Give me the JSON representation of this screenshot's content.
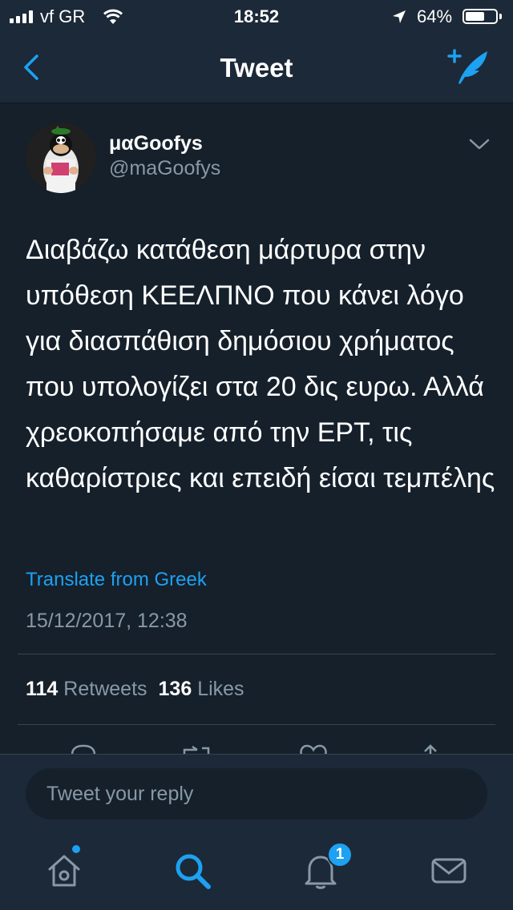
{
  "status_bar": {
    "carrier": "vf GR",
    "time": "18:52",
    "battery_percent": "64%",
    "battery_level": 0.64
  },
  "nav": {
    "title": "Tweet",
    "back_icon": "chevron-left-icon",
    "compose_icon": "compose-tweet-icon"
  },
  "tweet": {
    "display_name": "μαGoofys",
    "handle": "@maGoofys",
    "text": "Διαβάζω κατάθεση μάρτυρα στην υπόθεση ΚΕΕΛΠΝΟ που κάνει λόγο για διασπάθιση δημόσιου χρήματος που υπολογίζει στα 20 δις ευρω. Αλλά χρεοκοπήσαμε από την ΕΡΤ, τις καθαρίστριες και επειδή είσαι τεμπέλης",
    "translate_label": "Translate from Greek",
    "timestamp": "15/12/2017, 12:38",
    "retweets_count": "114",
    "retweets_label": "Retweets",
    "likes_count": "136",
    "likes_label": "Likes"
  },
  "reply": {
    "placeholder": "Tweet your reply"
  },
  "tabbar": {
    "items": [
      "home-icon",
      "search-icon",
      "notifications-icon",
      "messages-icon"
    ],
    "notifications_badge": "1"
  },
  "colors": {
    "background": "#15202b",
    "bar_background": "#1c2938",
    "accent": "#1da1f2",
    "secondary_text": "#8899a6",
    "divider": "#38444d"
  }
}
